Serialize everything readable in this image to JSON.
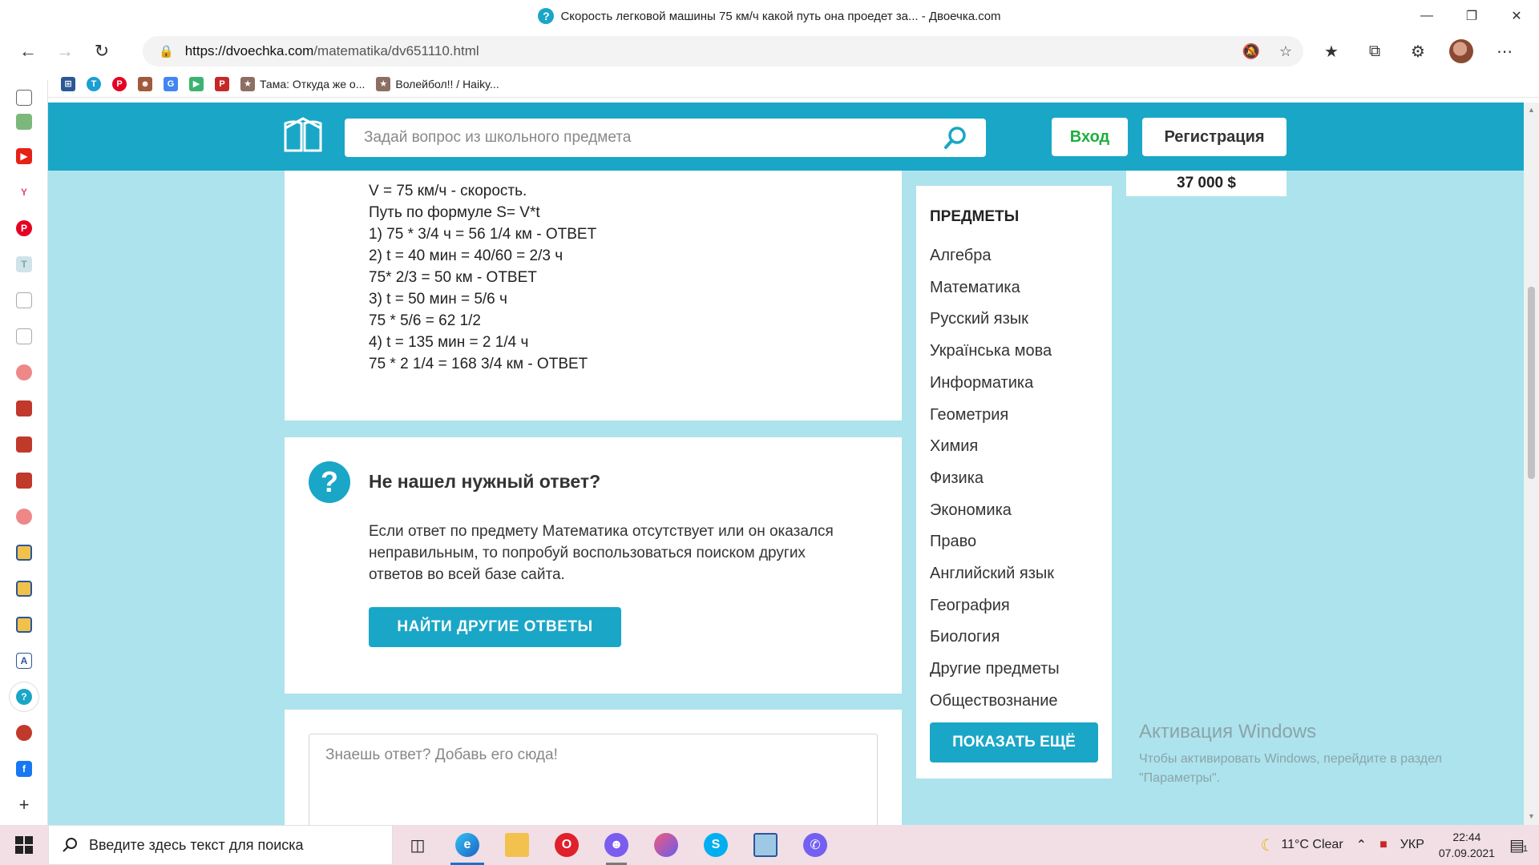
{
  "browser": {
    "window_title": "Скорость легковой машины 75 км/ч какой путь она проедет за... - Двоечка.com",
    "url_host": "https://dvoechka.com",
    "url_path": "/matematika/dv651110.html",
    "bookmarks": [
      {
        "icon": "calculator-icon",
        "label": ""
      },
      {
        "icon": "translate-icon",
        "label": ""
      },
      {
        "icon": "pinterest-icon",
        "label": ""
      },
      {
        "icon": "avatar-bookmark-icon",
        "label": ""
      },
      {
        "icon": "google-translate-icon",
        "label": ""
      },
      {
        "icon": "green-app-icon",
        "label": ""
      },
      {
        "icon": "pdf-icon",
        "label": ""
      },
      {
        "icon": "anime-icon",
        "label": "Тама: Откуда же о..."
      },
      {
        "icon": "anime-icon",
        "label": "Волейбол!! / Haiky..."
      }
    ]
  },
  "site": {
    "search_placeholder": "Задай вопрос из школьного предмета",
    "login_label": "Вход",
    "register_label": "Регистрация",
    "answer_lines": [
      "V = 75 км/ч -  скорость.",
      "Путь по формуле S= V*t",
      "1) 75 * 3/4 ч = 56 1/4 км - ОТВЕТ",
      "2) t = 40 мин = 40/60 = 2/3 ч",
      "75* 2/3 = 50 км - ОТВЕТ",
      "3) t = 50 мин = 5/6 ч",
      "75 * 5/6 = 62 1/2",
      "4) t = 135 мин = 2 1/4 ч",
      "75 * 2 1/4 = 168 3/4 км - ОТВЕТ"
    ],
    "no_answer": {
      "icon_glyph": "?",
      "title": "Не нашел нужный ответ?",
      "text": "Если ответ по предмету Математика отсутствует или он оказался неправильным, то попробуй воспользоваться поиском других ответов во всей базе сайта.",
      "button": "НАЙТИ ДРУГИЕ ОТВЕТЫ"
    },
    "add_answer_placeholder": "Знаешь ответ? Добавь его сюда!",
    "subjects": {
      "title": "ПРЕДМЕТЫ",
      "items": [
        "Алгебра",
        "Математика",
        "Русский язык",
        "Українська мова",
        "Информатика",
        "Геометрия",
        "Химия",
        "Физика",
        "Экономика",
        "Право",
        "Английский язык",
        "География",
        "Биология",
        "Другие предметы",
        "Обществознание"
      ],
      "more_button": "ПОКАЗАТЬ ЕЩЁ"
    },
    "prize": "37 000 $",
    "colors": {
      "brand": "#1aa6c7",
      "page_bg": "#ade3ec",
      "login_green": "#1fae3f"
    }
  },
  "watermark": {
    "title": "Активация Windows",
    "text": "Чтобы активировать Windows, перейдите в раздел \"Параметры\"."
  },
  "taskbar": {
    "search_placeholder": "Введите здесь текст для поиска",
    "weather": "11°C  Clear",
    "language": "УКР",
    "time": "22:44",
    "date": "07.09.2021",
    "notification_count": "1"
  }
}
